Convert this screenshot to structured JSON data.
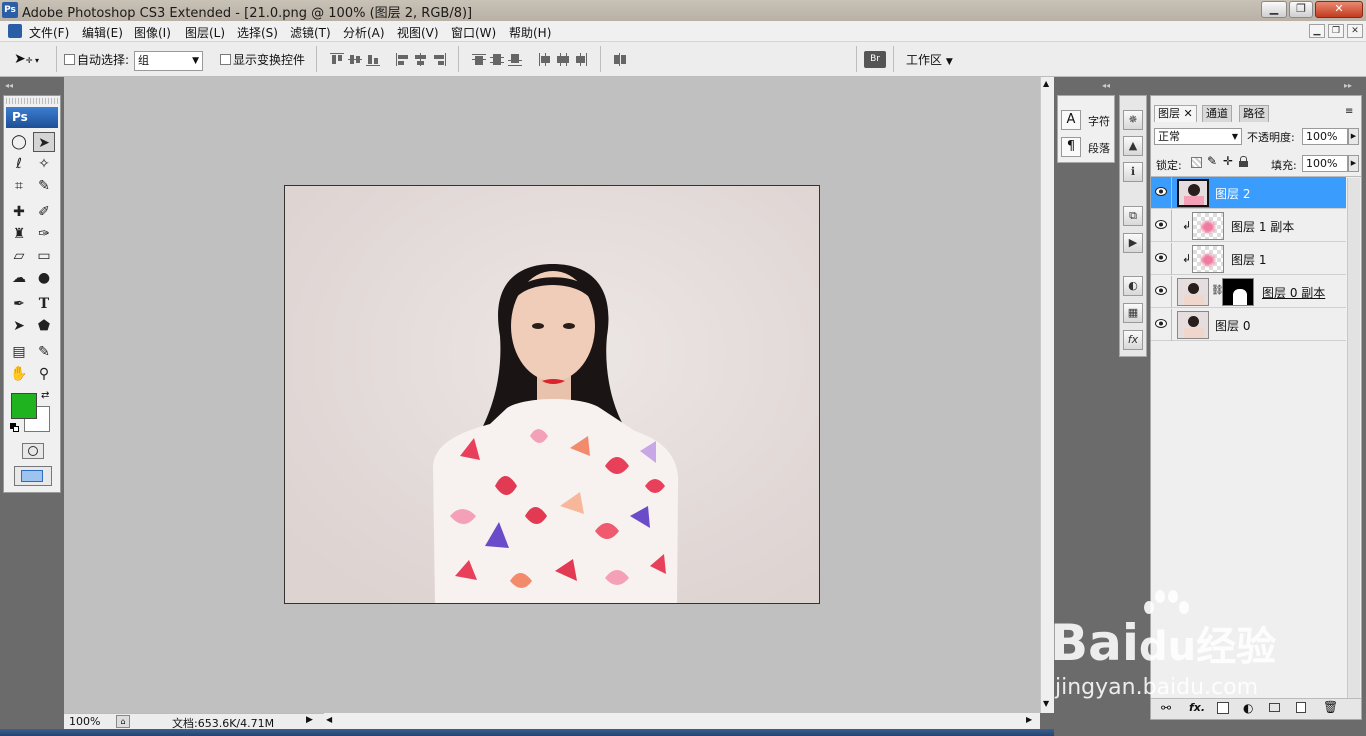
{
  "window": {
    "app_icon": "Ps",
    "title": "Adobe Photoshop CS3 Extended - [21.0.png @ 100% (图层 2, RGB/8)]"
  },
  "menu": [
    "文件(F)",
    "编辑(E)",
    "图像(I)",
    "图层(L)",
    "选择(S)",
    "滤镜(T)",
    "分析(A)",
    "视图(V)",
    "窗口(W)",
    "帮助(H)"
  ],
  "options": {
    "auto_select_label": "自动选择:",
    "auto_select_value": "组",
    "show_transform_label": "显示变换控件",
    "workspace_label": "工作区"
  },
  "toolbox": {
    "logo": "Ps",
    "foreground_color": "#1fb31f",
    "background_color": "#ffffff"
  },
  "status": {
    "zoom": "100%",
    "doc_size": "文档:653.6K/4.71M"
  },
  "char_panel": {
    "char_label": "字符",
    "para_label": "段落"
  },
  "layers_panel": {
    "tabs": [
      "图层",
      "通道",
      "路径"
    ],
    "blend_mode": "正常",
    "opacity_label": "不透明度:",
    "opacity_value": "100%",
    "lock_label": "锁定:",
    "fill_label": "填充:",
    "fill_value": "100%",
    "layers": [
      {
        "name": "图层 2",
        "selected": true
      },
      {
        "name": "图层 1 副本",
        "selected": false
      },
      {
        "name": "图层 1",
        "selected": false
      },
      {
        "name": "图层 0 副本",
        "selected": false
      },
      {
        "name": "图层 0",
        "selected": false
      }
    ]
  },
  "watermark": {
    "brand_latin": "Bai",
    "brand_du": "du",
    "brand_cn": "经验",
    "url": "jingyan.baidu.com"
  }
}
